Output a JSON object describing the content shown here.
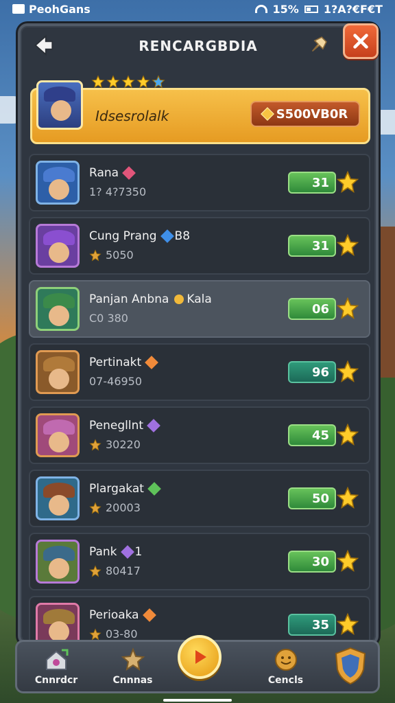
{
  "status_bar": {
    "app_name": "PeohGans",
    "battery": "15%",
    "time": "1?A?€F€T"
  },
  "header": {
    "title": "RENCARGBDIA",
    "back_icon": "arrow-left-icon",
    "pin_icon": "pin-icon",
    "close_icon": "close-icon"
  },
  "featured": {
    "stars": 5,
    "name": "Idsesrolalk",
    "button_label": "S500VB0R",
    "accent": "#f6c04a"
  },
  "rows": [
    {
      "name": "Rana",
      "sub": "1? 4?7350",
      "score": "31",
      "gem": "red",
      "avatar_color": "#2d5fa8",
      "hat_color": "#4a7bd0",
      "border": "blue",
      "sub_star": false,
      "pill": "green"
    },
    {
      "name": "Cung Prang",
      "name_extra": "B8",
      "sub": "5050",
      "score": "31",
      "gem": "blue",
      "avatar_color": "#6a3fa0",
      "hat_color": "#8a4fd0",
      "border": "purple",
      "sub_star": true,
      "pill": "green"
    },
    {
      "name": "Panjan Anbna",
      "name_extra": "Kala",
      "sub": "C0 380",
      "score": "06",
      "gem": "gold",
      "avatar_color": "#2f7a5a",
      "hat_color": "#3b8a4a",
      "border": "green",
      "sub_star": false,
      "pill": "green",
      "highlight": true
    },
    {
      "name": "Pertinakt",
      "sub": "07-46950",
      "score": "96",
      "gem": "orange",
      "avatar_color": "#8a5a2a",
      "hat_color": "#b07a3a",
      "border": "orange",
      "sub_star": false,
      "pill": "teal"
    },
    {
      "name": "Penegllnt",
      "sub": "30220",
      "score": "45",
      "gem": "purple",
      "avatar_color": "#a04a7a",
      "hat_color": "#c06ab0",
      "border": "orange",
      "sub_star": true,
      "pill": "green"
    },
    {
      "name": "Plargakat",
      "sub": "20003",
      "score": "50",
      "gem": "green",
      "avatar_color": "#2f6a8a",
      "hat_color": "#8a4a2a",
      "border": "blue",
      "sub_star": true,
      "pill": "green"
    },
    {
      "name": "Pank",
      "name_extra": "1",
      "sub": "80417",
      "score": "30",
      "gem": "purple",
      "avatar_color": "#5a7a3a",
      "hat_color": "#3b6a8a",
      "border": "purple",
      "sub_star": true,
      "pill": "green"
    },
    {
      "name": "Perioaka",
      "sub": "03-80",
      "score": "35",
      "gem": "orange",
      "avatar_color": "#7a3a5a",
      "hat_color": "#a07a3a",
      "border": "pink",
      "sub_star": true,
      "pill": "teal"
    }
  ],
  "bottom_nav": {
    "items": [
      {
        "label": "Cnnrdcr",
        "icon": "house-icon"
      },
      {
        "label": "Cnnnas",
        "icon": "star-badge-icon"
      },
      {
        "label": "",
        "icon": "play-icon"
      },
      {
        "label": "Cencls",
        "icon": "coin-face-icon"
      },
      {
        "label": "",
        "icon": "shield-icon"
      }
    ]
  }
}
